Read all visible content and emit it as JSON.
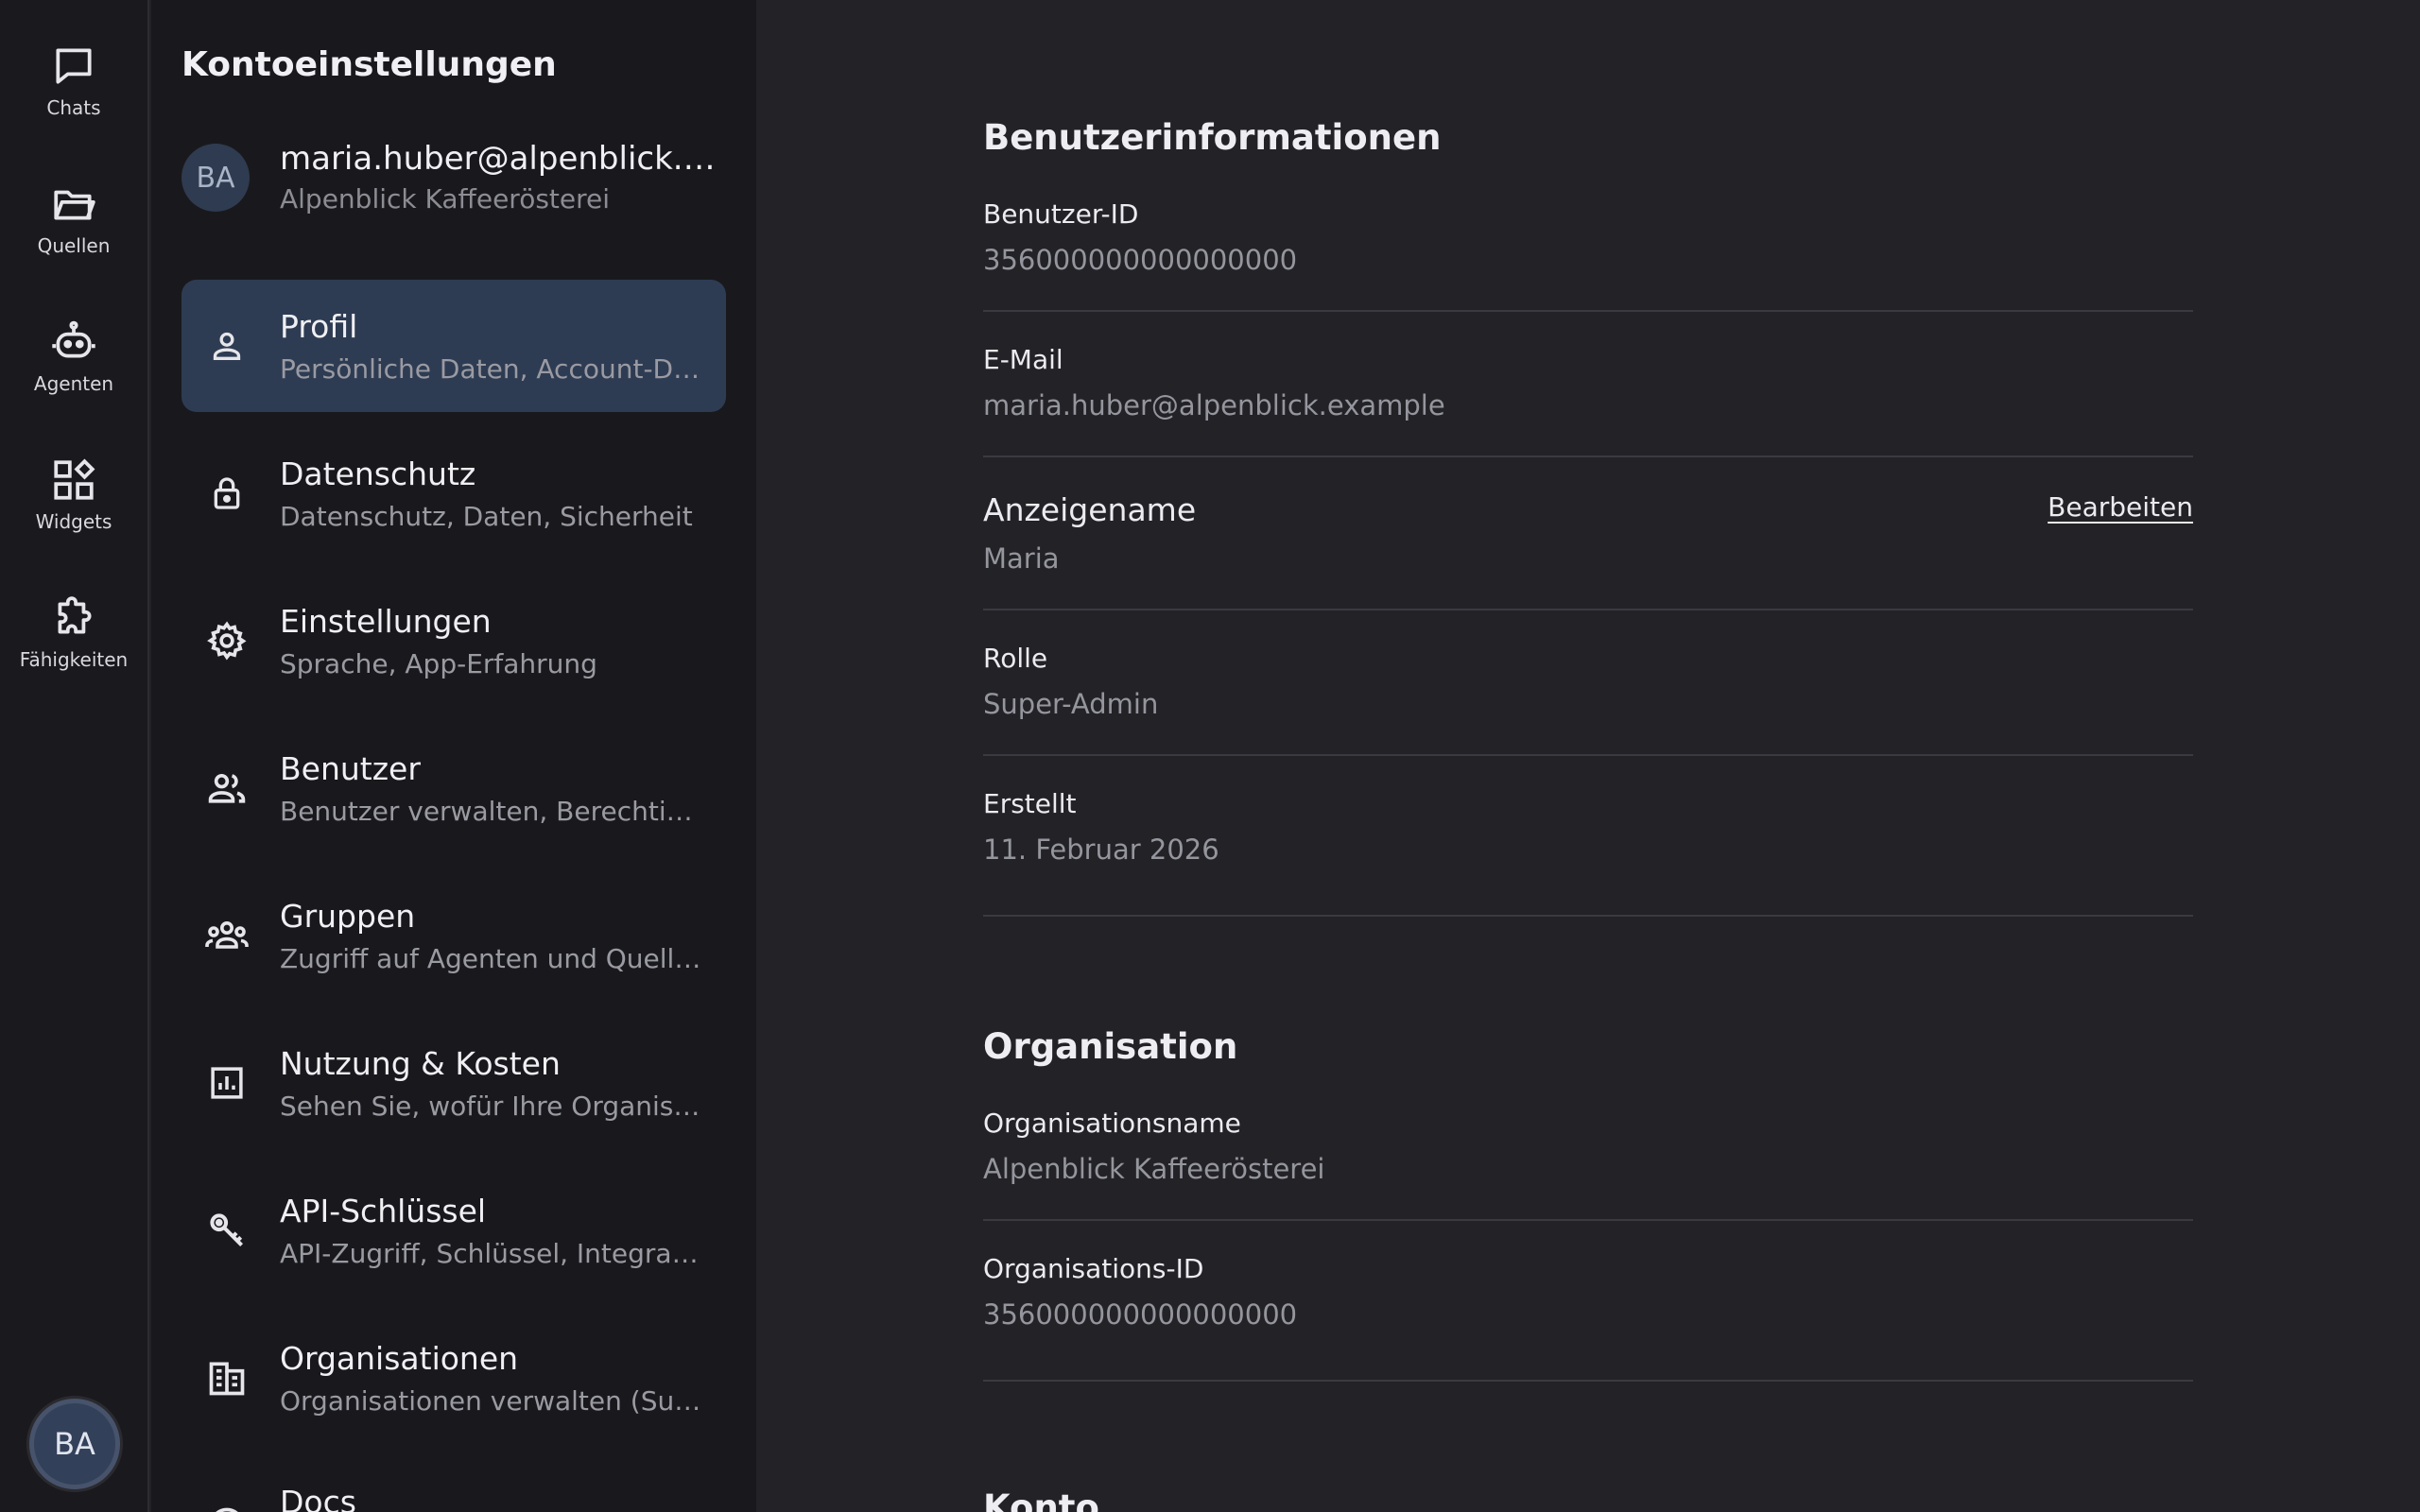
{
  "rail": {
    "items": [
      {
        "label": "Chats",
        "icon": "chat-icon"
      },
      {
        "label": "Quellen",
        "icon": "folder-icon"
      },
      {
        "label": "Agenten",
        "icon": "robot-icon"
      },
      {
        "label": "Widgets",
        "icon": "widgets-icon"
      },
      {
        "label": "Fähigkeiten",
        "icon": "puzzle-icon"
      }
    ],
    "avatar_initials": "BA"
  },
  "panel": {
    "title": "Kontoeinstellungen",
    "account": {
      "initials": "BA",
      "email": "maria.huber@alpenblick.example",
      "org": "Alpenblick Kaffeerösterei"
    },
    "items": [
      {
        "title": "Profil",
        "subtitle": "Persönliche Daten, Account-Details",
        "icon": "person-icon",
        "active": true
      },
      {
        "title": "Datenschutz",
        "subtitle": "Datenschutz, Daten, Sicherheit",
        "icon": "lock-icon"
      },
      {
        "title": "Einstellungen",
        "subtitle": "Sprache, App-Erfahrung",
        "icon": "gear-icon"
      },
      {
        "title": "Benutzer",
        "subtitle": "Benutzer verwalten, Berechtigungen",
        "icon": "users-icon"
      },
      {
        "title": "Gruppen",
        "subtitle": "Zugriff auf Agenten und Quellen",
        "icon": "groups-icon"
      },
      {
        "title": "Nutzung & Kosten",
        "subtitle": "Sehen Sie, wofür Ihre Organisation",
        "icon": "bar-chart-icon"
      },
      {
        "title": "API-Schlüssel",
        "subtitle": "API-Zugriff, Schlüssel, Integrationen",
        "icon": "key-icon"
      },
      {
        "title": "Organisationen",
        "subtitle": "Organisationen verwalten (Super-Admin)",
        "icon": "building-icon"
      },
      {
        "title": "Docs",
        "subtitle": "",
        "icon": "docs-icon"
      }
    ]
  },
  "main": {
    "user_section_title": "Benutzerinformationen",
    "user_fields": [
      {
        "label": "Benutzer-ID",
        "value": "356000000000000000"
      },
      {
        "label": "E-Mail",
        "value": "maria.huber@alpenblick.example"
      },
      {
        "label": "Anzeigename",
        "value": "Maria",
        "action": "Bearbeiten"
      },
      {
        "label": "Rolle",
        "value": "Super-Admin"
      },
      {
        "label": "Erstellt",
        "value": "11. Februar 2026"
      }
    ],
    "org_section_title": "Organisation",
    "org_fields": [
      {
        "label": "Organisationsname",
        "value": "Alpenblick Kaffeerösterei"
      },
      {
        "label": "Organisations-ID",
        "value": "356000000000000000"
      }
    ],
    "next_section_title": "Konto"
  },
  "colors": {
    "background": "#222227",
    "sidebar": "#19191d",
    "rail": "#1a1a1e",
    "active_item": "#2e3c53"
  }
}
